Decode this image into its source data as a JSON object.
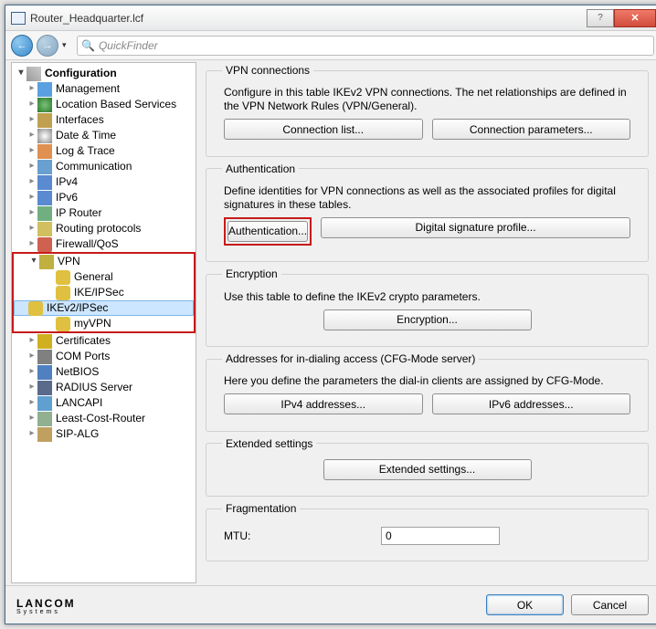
{
  "window": {
    "title": "Router_Headquarter.lcf"
  },
  "toolbar": {
    "quickfinder_placeholder": "QuickFinder"
  },
  "tree": {
    "root": "Configuration",
    "items": [
      {
        "label": "Management",
        "icon": "ic-mgmt"
      },
      {
        "label": "Location Based Services",
        "icon": "ic-globe"
      },
      {
        "label": "Interfaces",
        "icon": "ic-if"
      },
      {
        "label": "Date & Time",
        "icon": "ic-clock"
      },
      {
        "label": "Log & Trace",
        "icon": "ic-log"
      },
      {
        "label": "Communication",
        "icon": "ic-comm"
      },
      {
        "label": "IPv4",
        "icon": "ic-ip"
      },
      {
        "label": "IPv6",
        "icon": "ic-ip"
      },
      {
        "label": "IP Router",
        "icon": "ic-router"
      },
      {
        "label": "Routing protocols",
        "icon": "ic-proto"
      },
      {
        "label": "Firewall/QoS",
        "icon": "ic-fw"
      }
    ],
    "vpn": {
      "label": "VPN",
      "children": [
        {
          "label": "General",
          "icon": "ic-key"
        },
        {
          "label": "IKE/IPSec",
          "icon": "ic-key"
        },
        {
          "label": "IKEv2/IPSec",
          "icon": "ic-key",
          "selected": true
        },
        {
          "label": "myVPN",
          "icon": "ic-key"
        }
      ]
    },
    "after": [
      {
        "label": "Certificates",
        "icon": "ic-cert"
      },
      {
        "label": "COM Ports",
        "icon": "ic-com"
      },
      {
        "label": "NetBIOS",
        "icon": "ic-net"
      },
      {
        "label": "RADIUS Server",
        "icon": "ic-radius"
      },
      {
        "label": "LANCAPI",
        "icon": "ic-lancapi"
      },
      {
        "label": "Least-Cost-Router",
        "icon": "ic-least"
      },
      {
        "label": "SIP-ALG",
        "icon": "ic-sip"
      }
    ]
  },
  "panel": {
    "vpn_conn": {
      "legend": "VPN connections",
      "desc": "Configure in this table IKEv2 VPN connections. The net relationships are defined in the VPN Network Rules (VPN/General).",
      "btn_list": "Connection list...",
      "btn_params": "Connection parameters..."
    },
    "auth": {
      "legend": "Authentication",
      "desc": "Define identities for VPN connections as well as the associated profiles for digital signatures in these tables.",
      "btn_auth": "Authentication...",
      "btn_sig": "Digital signature profile..."
    },
    "enc": {
      "legend": "Encryption",
      "desc": "Use this table to define the IKEv2 crypto parameters.",
      "btn": "Encryption..."
    },
    "addr": {
      "legend": "Addresses for in-dialing access (CFG-Mode server)",
      "desc": "Here you define the parameters the dial-in clients are assigned by CFG-Mode.",
      "btn4": "IPv4 addresses...",
      "btn6": "IPv6 addresses..."
    },
    "ext": {
      "legend": "Extended settings",
      "btn": "Extended settings..."
    },
    "frag": {
      "legend": "Fragmentation",
      "mtu_label": "MTU:",
      "mtu_value": "0"
    }
  },
  "footer": {
    "brand": "LANCOM",
    "brand_sub": "Systems",
    "ok": "OK",
    "cancel": "Cancel"
  }
}
